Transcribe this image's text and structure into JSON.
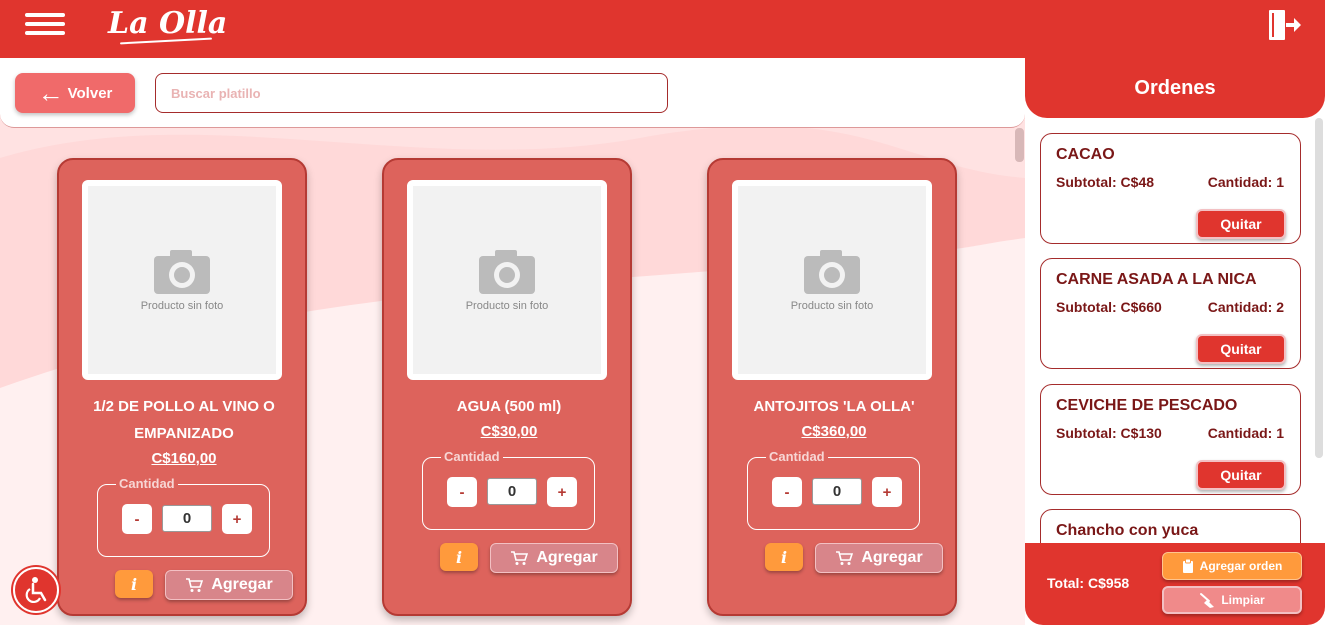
{
  "header": {
    "logo_text": "La Olla",
    "menu_icon": "hamburger-menu-icon",
    "logout_icon": "logout-door-icon",
    "color": "#e0352e"
  },
  "toolbar": {
    "back_label": "Volver",
    "search_placeholder": "Buscar platillo"
  },
  "products": [
    {
      "name": "1/2 DE POLLO AL VINO O EMPANIZADO",
      "price": "C$160,00",
      "photo_text": "Producto sin foto",
      "qty_label": "Cantidad",
      "qty": "0",
      "minus": "-",
      "plus": "+",
      "info": "i",
      "add_label": "Agregar"
    },
    {
      "name": "AGUA (500 ml)",
      "price": "C$30,00",
      "photo_text": "Producto sin foto",
      "qty_label": "Cantidad",
      "qty": "0",
      "minus": "-",
      "plus": "+",
      "info": "i",
      "add_label": "Agregar"
    },
    {
      "name": "ANTOJITOS 'LA OLLA'",
      "price": "C$360,00",
      "photo_text": "Producto sin foto",
      "qty_label": "Cantidad",
      "qty": "0",
      "minus": "-",
      "plus": "+",
      "info": "i",
      "add_label": "Agregar"
    }
  ],
  "orders_panel": {
    "title": "Ordenes",
    "items": [
      {
        "name": "CACAO",
        "subtotal": "Subtotal: C$48",
        "qty": "Cantidad: 1",
        "remove_label": "Quitar"
      },
      {
        "name": "CARNE ASADA A LA NICA",
        "subtotal": "Subtotal: C$660",
        "qty": "Cantidad: 2",
        "remove_label": "Quitar"
      },
      {
        "name": "CEVICHE DE PESCADO",
        "subtotal": "Subtotal: C$130",
        "qty": "Cantidad: 1",
        "remove_label": "Quitar"
      },
      {
        "name": "Chancho con yuca"
      }
    ],
    "total": "Total: C$958",
    "add_order_label": "Agregar orden",
    "clear_label": "Limpiar"
  }
}
